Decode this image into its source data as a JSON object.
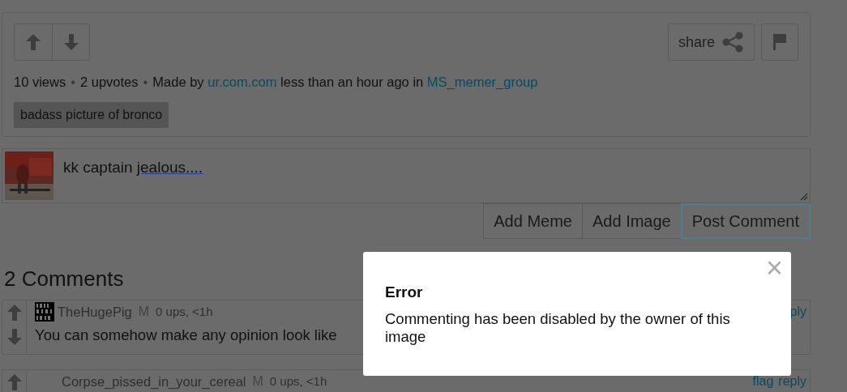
{
  "post": {
    "stats": [
      {
        "text": "10 views"
      },
      {
        "text": "2 upvotes"
      }
    ],
    "separator": "•",
    "made_by_label": "Made by",
    "author": "ur.com.com",
    "time_text": "less than an hour ago in",
    "group": "MS_memer_group",
    "share_label": "share",
    "tag": "badass picture of bronco"
  },
  "comment_box": {
    "value": "kk captain jealous....",
    "buttons": [
      {
        "label": "Add Meme",
        "focused": false
      },
      {
        "label": "Add Image",
        "focused": false
      },
      {
        "label": "Post Comment",
        "focused": true
      }
    ]
  },
  "comments_heading": "2 Comments",
  "comments": [
    {
      "user": "TheHugePig",
      "mod_mark": "M",
      "meta": "0 ups, <1h",
      "text": "You can somehow make any opinion look like",
      "actions": [
        "ply"
      ],
      "has_avatar": true
    },
    {
      "user": "Corpse_pissed_in_your_cereal",
      "mod_mark": "M",
      "meta": "0 ups, <1h",
      "actions": [
        "flag",
        "reply"
      ],
      "has_avatar": false
    }
  ],
  "dialog": {
    "title": "Error",
    "message": "Commenting has been disabled by the owner of this image",
    "close": "×"
  }
}
